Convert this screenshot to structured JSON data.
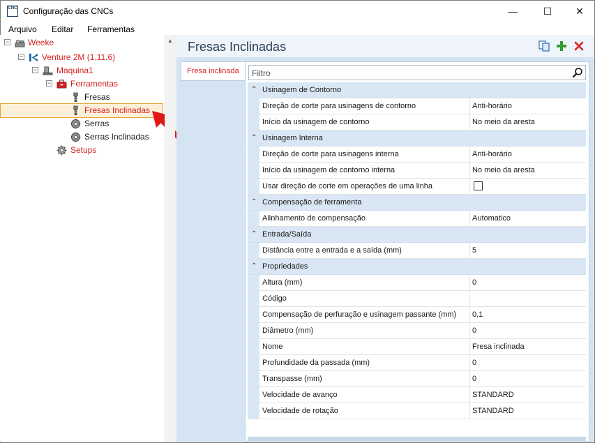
{
  "window": {
    "title": "Configuração das CNCs",
    "app_icon_text": "CNC",
    "controls": {
      "minimize": "—",
      "maximize": "☐",
      "close": "✕"
    }
  },
  "menu": {
    "items": [
      "Arquivo",
      "Editar",
      "Ferramentas"
    ]
  },
  "tree": {
    "nodes": [
      {
        "label": "Weeke",
        "icon": "machine-icon"
      },
      {
        "label": "Venture 2M (1.11.6)",
        "icon": "cnc-model-icon"
      },
      {
        "label": "Maquina1",
        "icon": "machine-unit-icon"
      },
      {
        "label": "Ferramentas",
        "icon": "toolbox-icon"
      },
      {
        "label": "Fresas",
        "icon": "router-bit-icon"
      },
      {
        "label": "Fresas Inclinadas",
        "icon": "router-bit-icon",
        "selected": true
      },
      {
        "label": "Serras",
        "icon": "saw-blade-icon"
      },
      {
        "label": "Serras Inclinadas",
        "icon": "saw-blade-icon"
      },
      {
        "label": "Setups",
        "icon": "gear-icon"
      }
    ]
  },
  "header": {
    "title": "Fresas Inclinadas",
    "actions": [
      "copy-icon",
      "add-icon",
      "delete-icon"
    ]
  },
  "tabs": [
    {
      "label": "Fresa inclinada"
    }
  ],
  "filter": {
    "placeholder": "Filtro"
  },
  "properties": {
    "categories": [
      {
        "label": "Usinagem de Contorno",
        "rows": [
          {
            "name": "Direção de corte para usinagens de contorno",
            "value": "Anti-horário"
          },
          {
            "name": "Início da usinagem de contorno",
            "value": "No meio da aresta"
          }
        ]
      },
      {
        "label": "Usinagem Interna",
        "rows": [
          {
            "name": "Direção de corte para usinagens interna",
            "value": "Anti-horário"
          },
          {
            "name": "Início da usinagem de contorno interna",
            "value": "No meio da aresta"
          },
          {
            "name": "Usar direção de corte em operações de uma linha",
            "value": "",
            "checkbox": true,
            "checked": false
          }
        ]
      },
      {
        "label": "Compensação de ferramenta",
        "rows": [
          {
            "name": "Alinhamento de compensação",
            "value": "Automatico"
          }
        ]
      },
      {
        "label": "Entrada/Saída",
        "rows": [
          {
            "name": "Distância entre a entrada e a saída (mm)",
            "value": "5"
          }
        ]
      },
      {
        "label": "Propriedades",
        "rows": [
          {
            "name": "Altura (mm)",
            "value": "0"
          },
          {
            "name": "Código",
            "value": ""
          },
          {
            "name": "Compensação de perfuração e usinagem passante (mm)",
            "value": "0,1"
          },
          {
            "name": "Diâmetro (mm)",
            "value": "0"
          },
          {
            "name": "Nome",
            "value": "Fresa inclinada"
          },
          {
            "name": "Profundidade da passada (mm)",
            "value": "0"
          },
          {
            "name": "Transpasse (mm)",
            "value": "0"
          },
          {
            "name": "Velocidade de avanço",
            "value": "STANDARD"
          },
          {
            "name": "Velocidade de rotação",
            "value": "STANDARD"
          }
        ]
      }
    ]
  },
  "colors": {
    "accent_red": "#d42020",
    "header_bg": "#eef4fa",
    "content_bg": "#d4e4f3",
    "category_bg": "#d9e7f4",
    "selection_border": "#e8a23a"
  }
}
